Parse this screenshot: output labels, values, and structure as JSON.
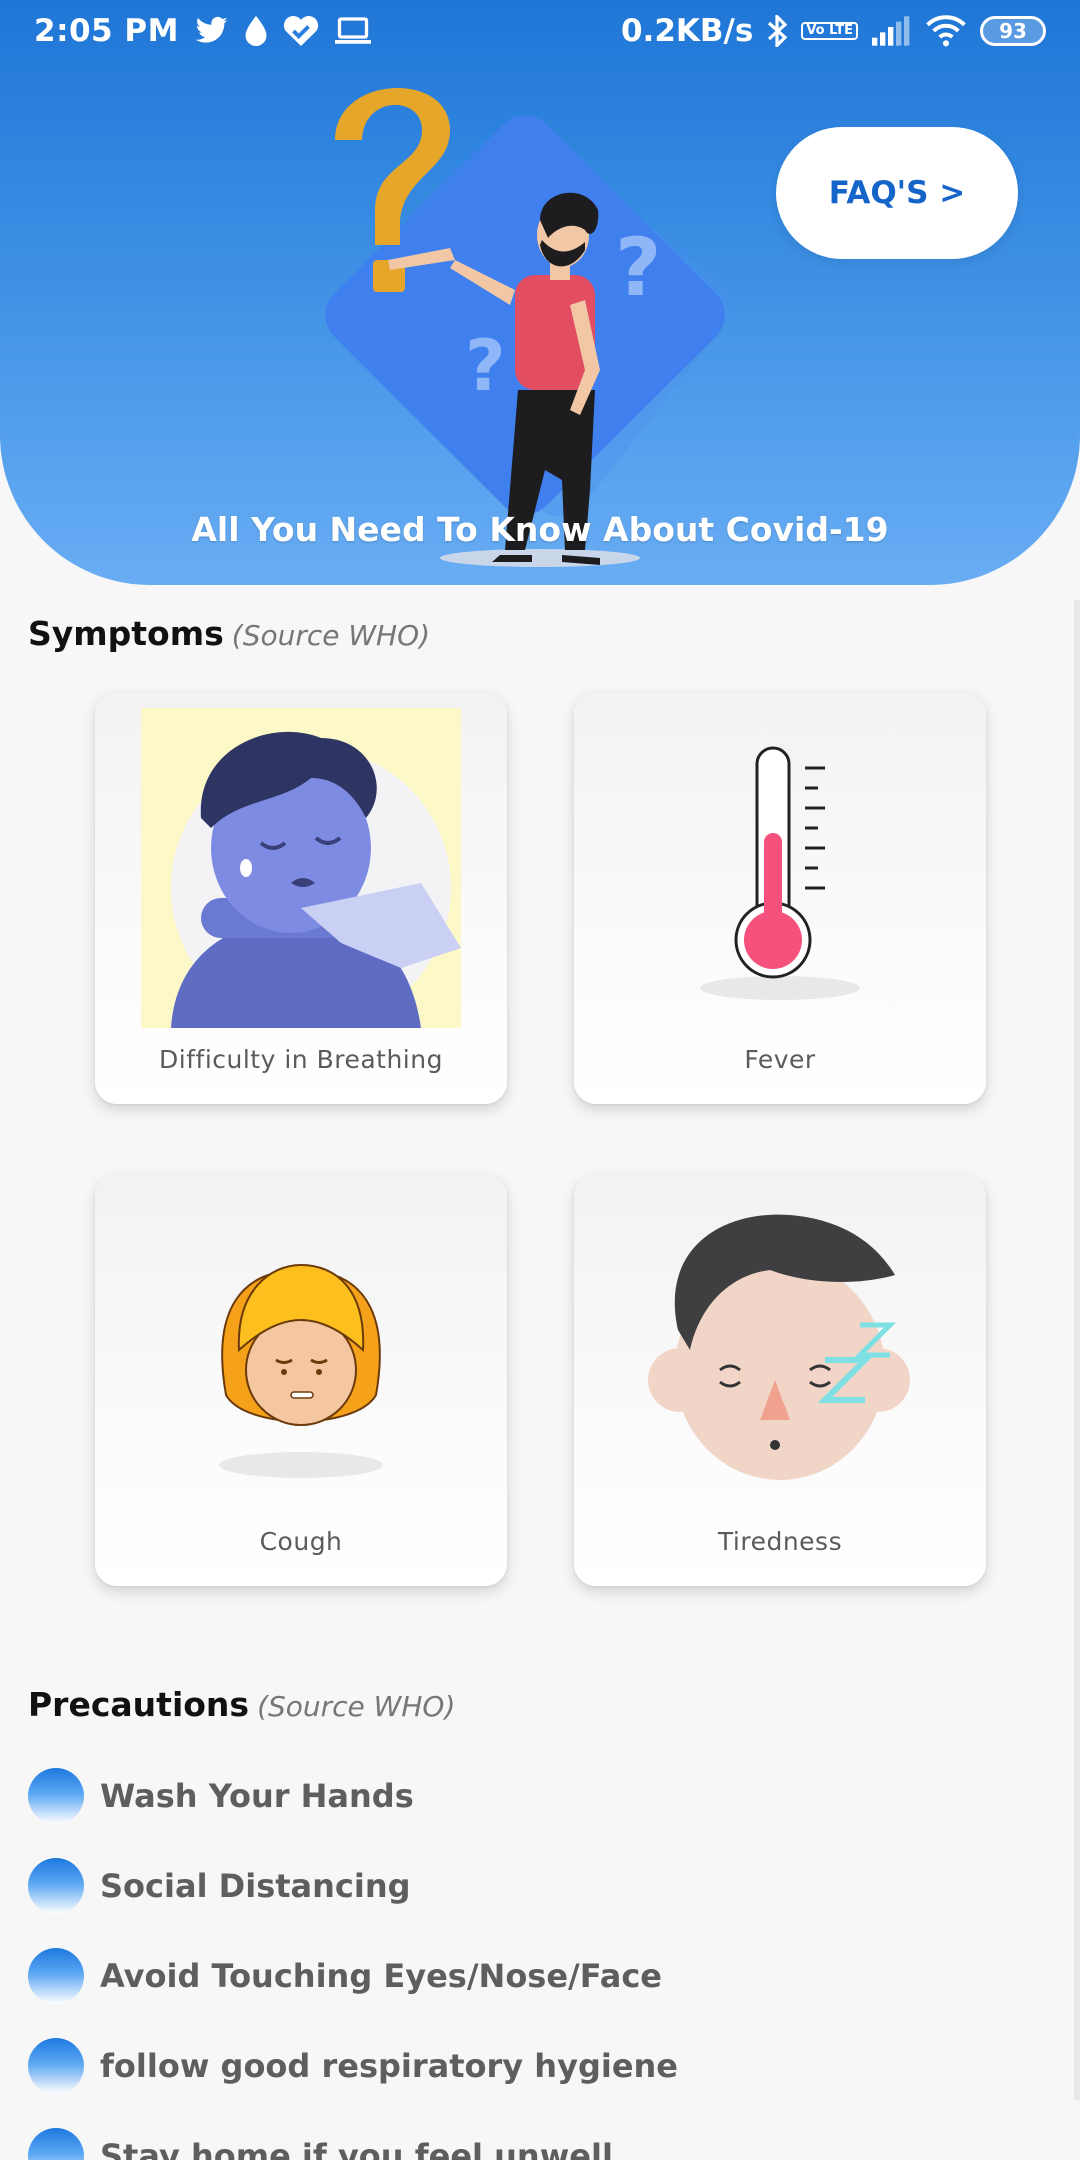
{
  "status_bar": {
    "time": "2:05 PM",
    "net_speed": "0.2KB/s",
    "volte": "Vo LTE",
    "battery": "93",
    "left_icons": [
      "twitter-icon",
      "drop-icon",
      "heart-check-icon",
      "laptop-icon"
    ],
    "right_icons": [
      "bluetooth-icon",
      "volte-icon",
      "signal-icon",
      "wifi-icon",
      "battery-icon"
    ]
  },
  "header": {
    "faq_label": "FAQ'S >",
    "title": "All You Need To Know About Covid-19",
    "colors": {
      "top": "#1f76d6",
      "bottom": "#69adf4"
    }
  },
  "symptoms": {
    "title": "Symptoms",
    "source": "(Source WHO)",
    "cards": [
      {
        "label": "Difficulty in Breathing",
        "icon": "breathing-illustration"
      },
      {
        "label": "Fever",
        "icon": "thermometer-illustration"
      },
      {
        "label": "Cough",
        "icon": "cough-illustration"
      },
      {
        "label": "Tiredness",
        "icon": "sleepy-face-illustration"
      }
    ]
  },
  "precautions": {
    "title": "Precautions",
    "source": "(Source WHO)",
    "items": [
      "Wash Your Hands",
      "Social Distancing",
      "Avoid Touching Eyes/Nose/Face",
      "follow good respiratory hygiene",
      "Stay home if you feel unwell"
    ]
  }
}
